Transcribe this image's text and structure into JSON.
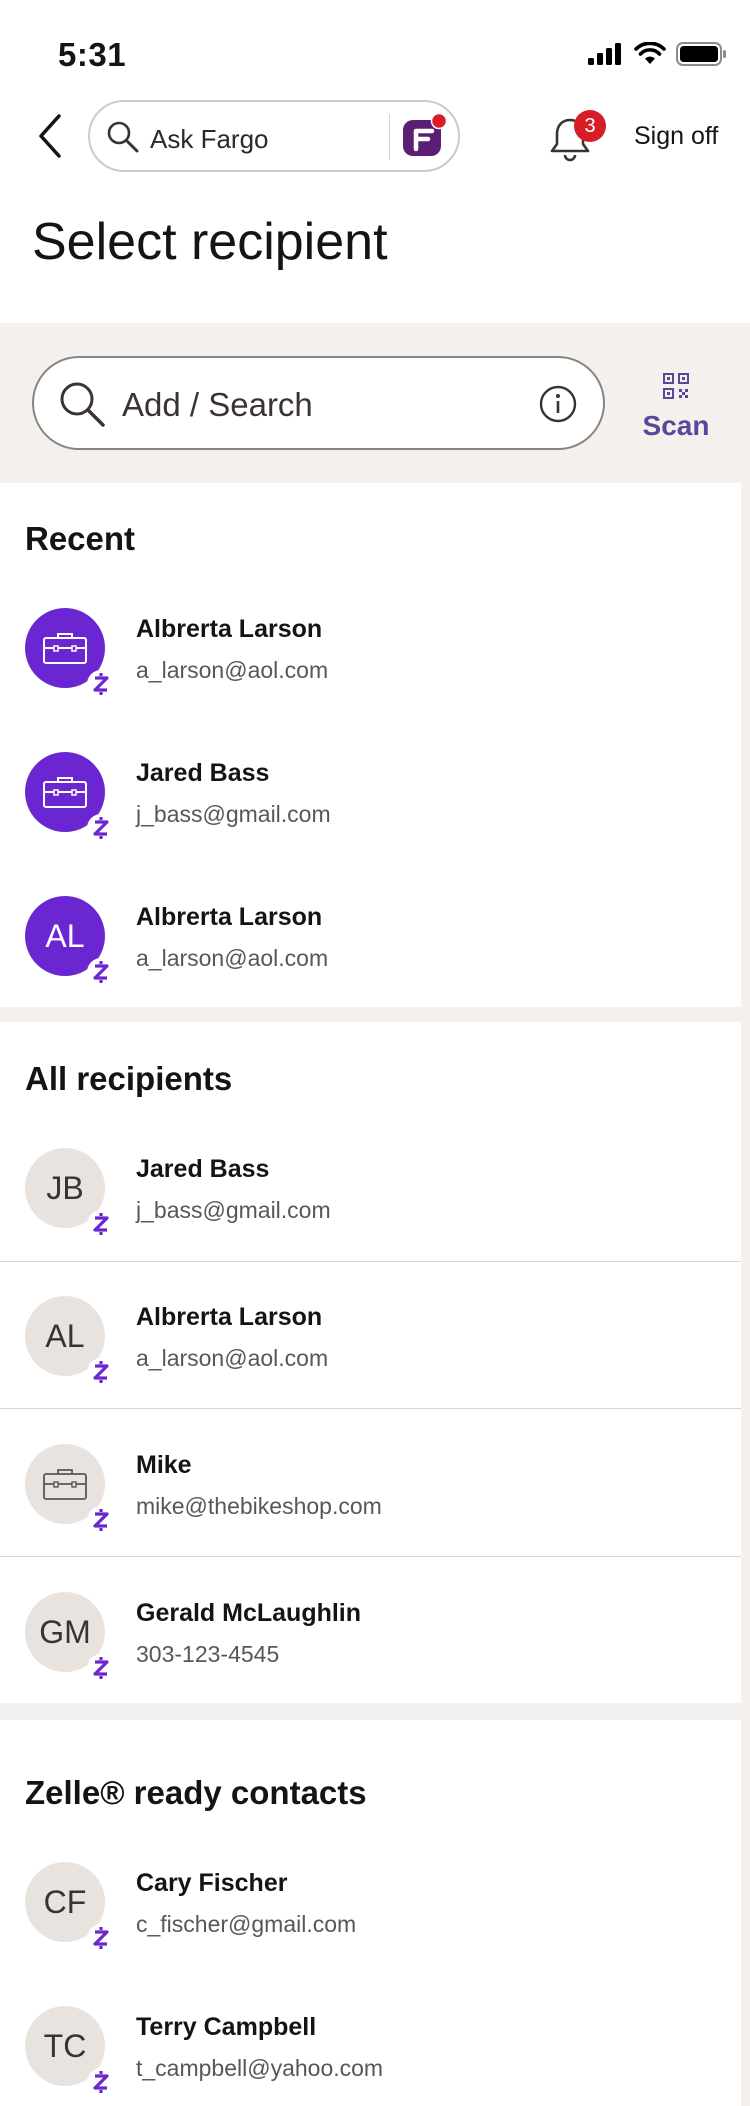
{
  "status_bar": {
    "time": "5:31"
  },
  "nav": {
    "ask_placeholder": "Ask Fargo",
    "notification_count": "3",
    "sign_off": "Sign off"
  },
  "page_title": "Select recipient",
  "search": {
    "placeholder": "Add / Search",
    "scan_label": "Scan"
  },
  "recent": {
    "title": "Recent",
    "items": [
      {
        "name": "Albrerta Larson",
        "detail": "a_larson@aol.com",
        "avatar": "briefcase-icon"
      },
      {
        "name": "Jared Bass",
        "detail": "j_bass@gmail.com",
        "avatar": "briefcase-icon"
      },
      {
        "name": "Albrerta Larson",
        "detail": "a_larson@aol.com",
        "initials": "AL"
      }
    ]
  },
  "all_recipients": {
    "title": "All recipients",
    "items": [
      {
        "name": "Jared Bass",
        "detail": "j_bass@gmail.com",
        "initials": "JB"
      },
      {
        "name": "Albrerta Larson",
        "detail": "a_larson@aol.com",
        "initials": "AL"
      },
      {
        "name": "Mike",
        "detail": "mike@thebikeshop.com",
        "avatar": "briefcase-icon"
      },
      {
        "name": "Gerald McLaughlin",
        "detail": "303-123-4545",
        "initials": "GM"
      }
    ]
  },
  "zelle_contacts": {
    "title": "Zelle® ready contacts",
    "items": [
      {
        "name": "Cary Fischer",
        "detail": "c_fischer@gmail.com",
        "initials": "CF"
      },
      {
        "name": "Terry Campbell",
        "detail": "t_campbell@yahoo.com",
        "initials": "TC"
      }
    ]
  },
  "colors": {
    "accent_purple": "#6a27d1",
    "brand_red": "#d71e28",
    "scan_purple": "#5a469b"
  }
}
